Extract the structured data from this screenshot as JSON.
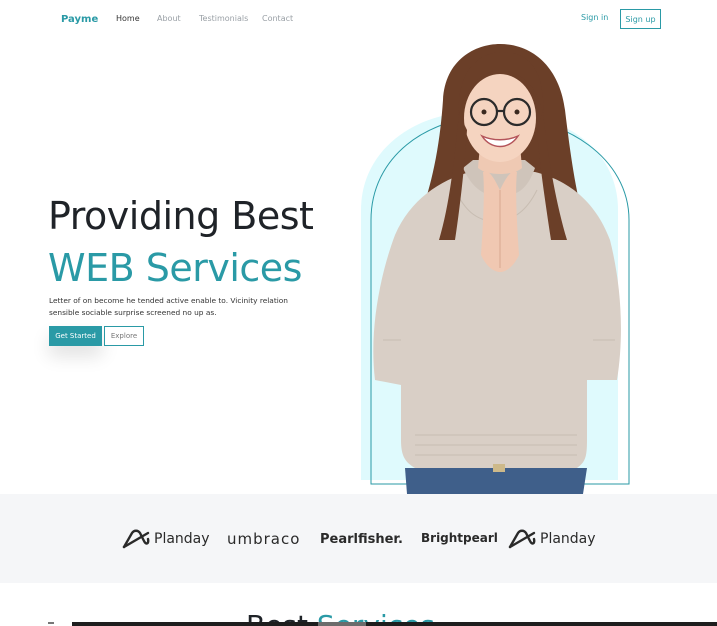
{
  "nav": {
    "logo": "Payme",
    "links": [
      "Home",
      "About",
      "Testimonials",
      "Contact"
    ],
    "active": "Home",
    "signin": "Sign in",
    "signup": "Sign up"
  },
  "hero": {
    "title_line1": "Providing Best",
    "title_line2": "WEB Services",
    "description": "Letter of on become he tended active enable to. Vicinity relation sensible sociable surprise screened no up as.",
    "primary_button": "Get Started",
    "secondary_button": "Explore"
  },
  "brands": [
    "Planday",
    "umbraco",
    "Pearlfisher.",
    "Brightpearl",
    "Planday"
  ],
  "next_section": {
    "heading_part1": "Best",
    "heading_part2": "Services"
  },
  "colors": {
    "accent": "#2a9aa6",
    "arch_fill": "#dffafd",
    "strip_bg": "#f5f6f8"
  }
}
